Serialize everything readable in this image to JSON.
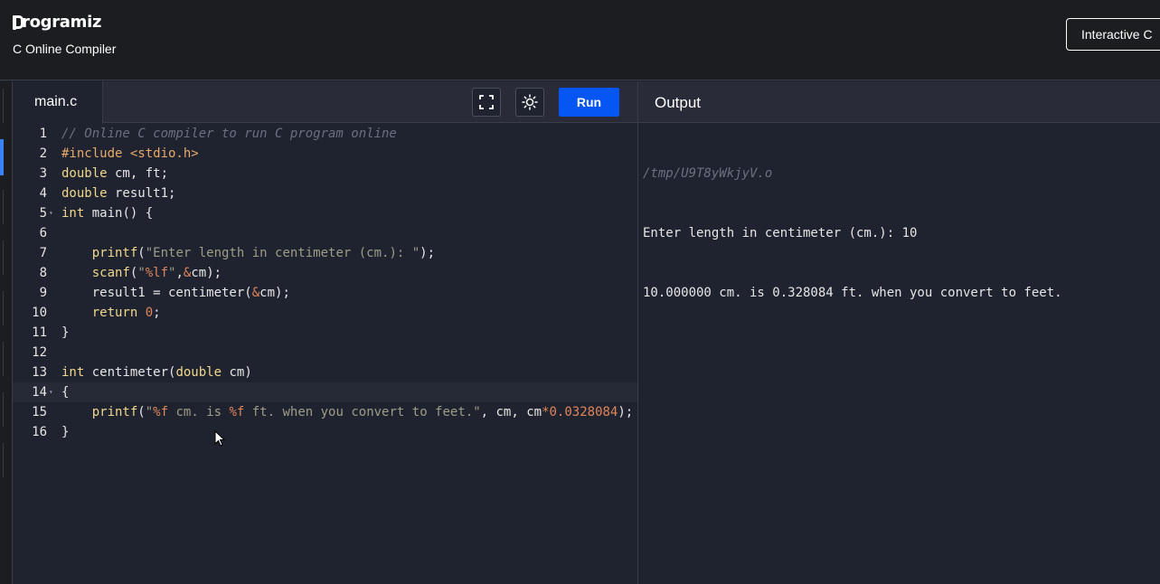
{
  "header": {
    "logo_text": "rogramiz",
    "subtitle": "C Online Compiler",
    "interactive_button": "Interactive C"
  },
  "editor": {
    "tab_label": "main.c",
    "fullscreen_icon": "fullscreen-icon",
    "theme_icon": "sun-icon",
    "run_label": "Run",
    "lines": [
      {
        "n": "1",
        "fold": false,
        "tokens": [
          {
            "c": "c-cm",
            "t": "// Online C compiler to run C program online"
          }
        ]
      },
      {
        "n": "2",
        "fold": false,
        "tokens": [
          {
            "c": "c-pp",
            "t": "#include <stdio.h>"
          }
        ]
      },
      {
        "n": "3",
        "fold": false,
        "tokens": [
          {
            "c": "c-kw",
            "t": "double"
          },
          {
            "c": "c-pl",
            "t": " cm, ft;"
          }
        ]
      },
      {
        "n": "4",
        "fold": false,
        "tokens": [
          {
            "c": "c-kw",
            "t": "double"
          },
          {
            "c": "c-pl",
            "t": " result1;"
          }
        ]
      },
      {
        "n": "5",
        "fold": true,
        "tokens": [
          {
            "c": "c-kw",
            "t": "int"
          },
          {
            "c": "c-pl",
            "t": " main() {"
          }
        ]
      },
      {
        "n": "6",
        "fold": false,
        "tokens": []
      },
      {
        "n": "7",
        "fold": false,
        "tokens": [
          {
            "c": "c-pl",
            "t": "    "
          },
          {
            "c": "c-fn",
            "t": "printf"
          },
          {
            "c": "c-pl",
            "t": "("
          },
          {
            "c": "c-st",
            "t": "\"Enter length in centimeter (cm.): \""
          },
          {
            "c": "c-pl",
            "t": ");"
          }
        ]
      },
      {
        "n": "8",
        "fold": false,
        "tokens": [
          {
            "c": "c-pl",
            "t": "    "
          },
          {
            "c": "c-fn",
            "t": "scanf"
          },
          {
            "c": "c-pl",
            "t": "("
          },
          {
            "c": "c-st",
            "t": "\""
          },
          {
            "c": "c-nu",
            "t": "%lf"
          },
          {
            "c": "c-st",
            "t": "\""
          },
          {
            "c": "c-pl",
            "t": ","
          },
          {
            "c": "c-op",
            "t": "&"
          },
          {
            "c": "c-pl",
            "t": "cm);"
          }
        ]
      },
      {
        "n": "9",
        "fold": false,
        "tokens": [
          {
            "c": "c-pl",
            "t": "    result1 = centimeter("
          },
          {
            "c": "c-op",
            "t": "&"
          },
          {
            "c": "c-pl",
            "t": "cm);"
          }
        ]
      },
      {
        "n": "10",
        "fold": false,
        "tokens": [
          {
            "c": "c-pl",
            "t": "    "
          },
          {
            "c": "c-kw",
            "t": "return"
          },
          {
            "c": "c-pl",
            "t": " "
          },
          {
            "c": "c-nu",
            "t": "0"
          },
          {
            "c": "c-pl",
            "t": ";"
          }
        ]
      },
      {
        "n": "11",
        "fold": false,
        "tokens": [
          {
            "c": "c-pl",
            "t": "}"
          }
        ]
      },
      {
        "n": "12",
        "fold": false,
        "tokens": []
      },
      {
        "n": "13",
        "fold": false,
        "tokens": [
          {
            "c": "c-kw",
            "t": "int"
          },
          {
            "c": "c-pl",
            "t": " centimeter("
          },
          {
            "c": "c-kw",
            "t": "double"
          },
          {
            "c": "c-pl",
            "t": " cm)"
          }
        ]
      },
      {
        "n": "14",
        "fold": true,
        "active": true,
        "tokens": [
          {
            "c": "c-pl",
            "t": "{"
          }
        ]
      },
      {
        "n": "15",
        "fold": false,
        "tokens": [
          {
            "c": "c-pl",
            "t": "    "
          },
          {
            "c": "c-fn",
            "t": "printf"
          },
          {
            "c": "c-pl",
            "t": "("
          },
          {
            "c": "c-st",
            "t": "\""
          },
          {
            "c": "c-nu",
            "t": "%f"
          },
          {
            "c": "c-st",
            "t": " cm. is "
          },
          {
            "c": "c-nu",
            "t": "%f"
          },
          {
            "c": "c-st",
            "t": " ft. when you convert to feet.\""
          },
          {
            "c": "c-pl",
            "t": ", cm, cm"
          },
          {
            "c": "c-op",
            "t": "*"
          },
          {
            "c": "c-nu",
            "t": "0.0328084"
          },
          {
            "c": "c-pl",
            "t": ");"
          }
        ]
      },
      {
        "n": "16",
        "fold": false,
        "tokens": [
          {
            "c": "c-pl",
            "t": "}"
          }
        ]
      }
    ]
  },
  "output": {
    "title": "Output",
    "path": "/tmp/U9T8yWkjyV.o",
    "lines": [
      "Enter length in centimeter (cm.): 10",
      "10.000000 cm. is 0.328084 ft. when you convert to feet."
    ]
  }
}
